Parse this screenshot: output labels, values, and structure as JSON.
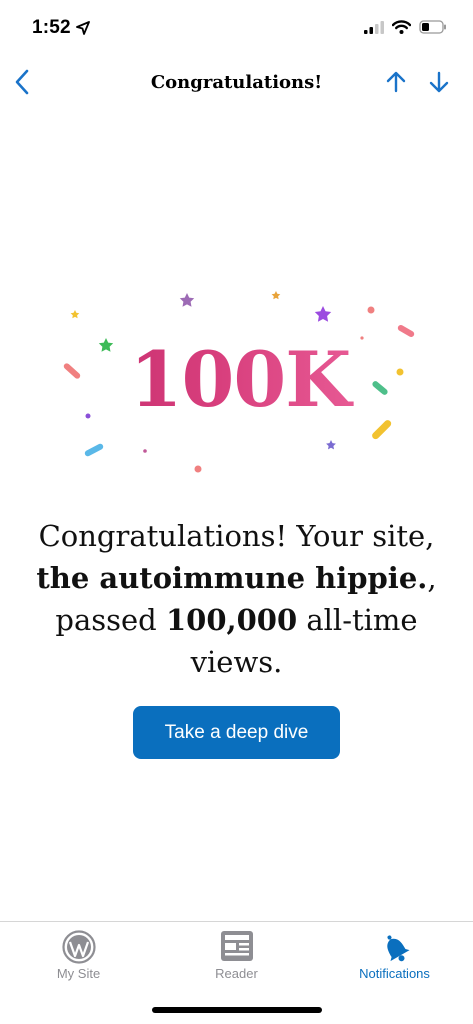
{
  "status": {
    "time": "1:52",
    "location_icon": "location-arrow-icon"
  },
  "nav": {
    "title": "Congratulations!",
    "back_icon": "chevron-left-icon",
    "up_icon": "arrow-up-icon",
    "down_icon": "arrow-down-icon",
    "accent": "#1a73c9"
  },
  "hero": {
    "milestone": "100K",
    "gradient": [
      "#c32a6b",
      "#f06aa2"
    ]
  },
  "message": {
    "prefix": "Congratulations! Your site, ",
    "site_name": "the autoimmune hippie.",
    "middle": ", passed ",
    "count": "100,000",
    "suffix": " all-time views."
  },
  "cta": {
    "label": "Take a deep dive",
    "color": "#0a6fbe"
  },
  "tabs": [
    {
      "label": "My Site",
      "icon": "wordpress-icon",
      "active": false
    },
    {
      "label": "Reader",
      "icon": "newspaper-icon",
      "active": false
    },
    {
      "label": "Notifications",
      "icon": "bell-icon",
      "active": true
    }
  ]
}
